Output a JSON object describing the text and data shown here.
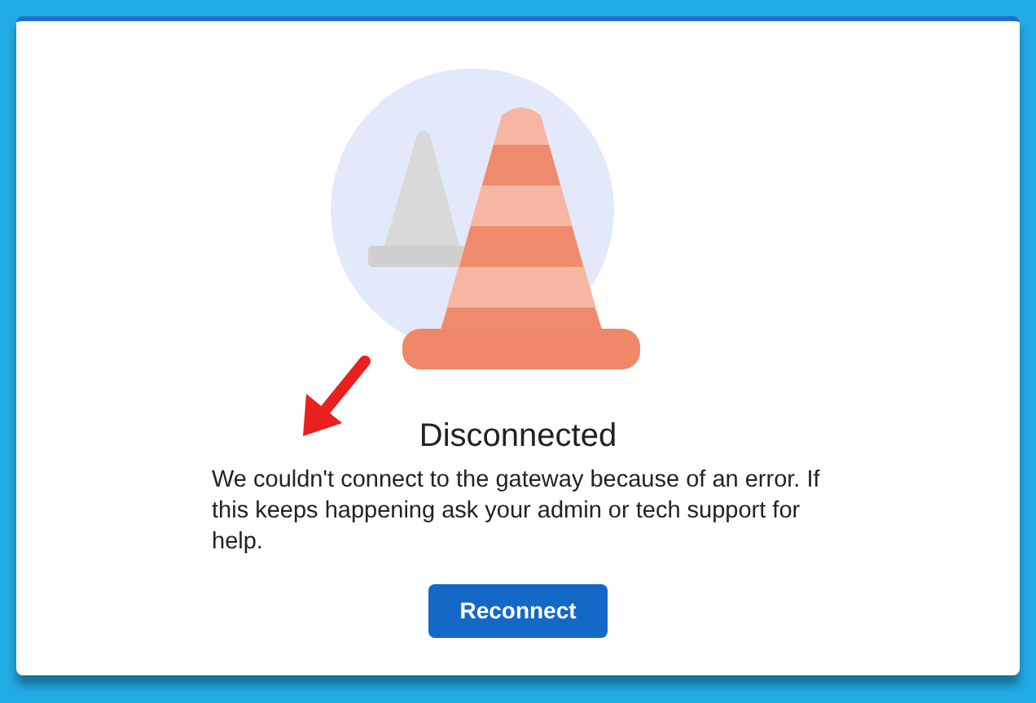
{
  "dialog": {
    "title": "Disconnected",
    "message": "We couldn't connect to the gateway because of an error. If this keeps happening ask your admin or tech support for help.",
    "button": "Reconnect"
  }
}
